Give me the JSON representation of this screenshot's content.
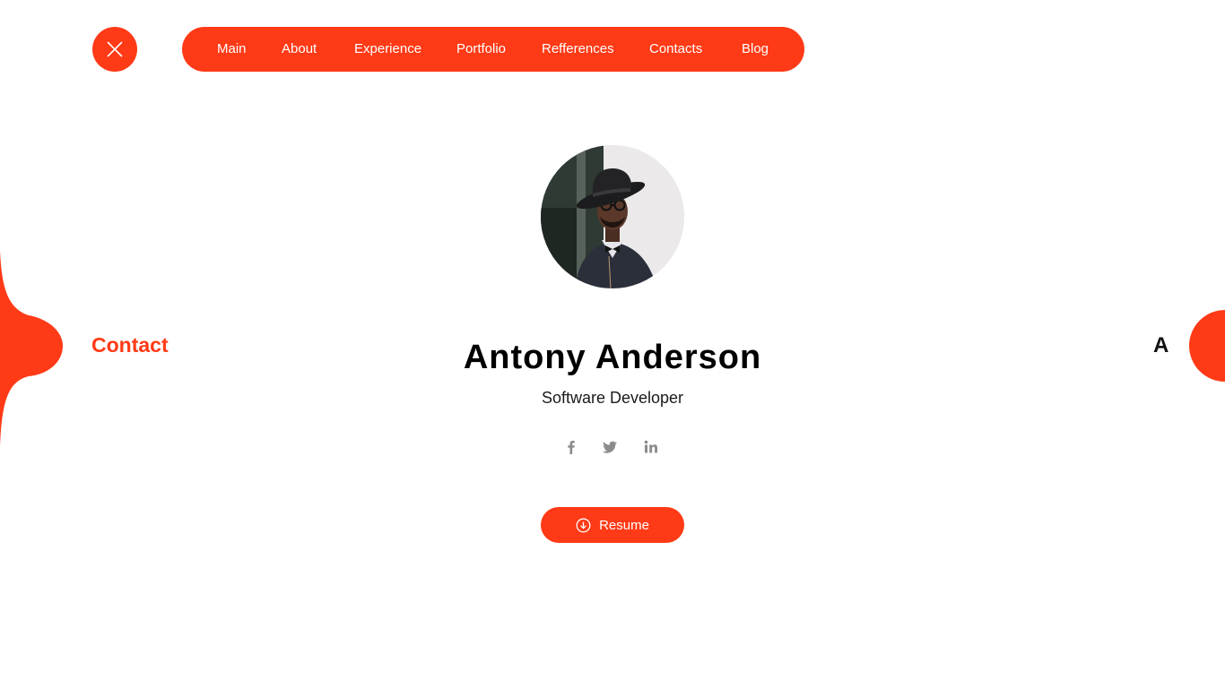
{
  "colors": {
    "accent": "#ff3a16",
    "text": "#000000",
    "social_icon": "#8c8c8c",
    "background": "#ffffff"
  },
  "header": {
    "close_icon": "close-icon",
    "nav": [
      {
        "label": "Main"
      },
      {
        "label": "About"
      },
      {
        "label": "Experience"
      },
      {
        "label": "Portfolio"
      },
      {
        "label": "Refferences"
      },
      {
        "label": "Contacts"
      },
      {
        "label": "Blog"
      }
    ]
  },
  "side": {
    "left_label": "Contact",
    "right_label": "A"
  },
  "profile": {
    "name": "Antony Anderson",
    "role": "Software Developer",
    "social": [
      {
        "icon": "facebook-icon"
      },
      {
        "icon": "twitter-icon"
      },
      {
        "icon": "linkedin-icon"
      }
    ],
    "resume_label": "Resume",
    "resume_icon": "download-circle-icon"
  }
}
